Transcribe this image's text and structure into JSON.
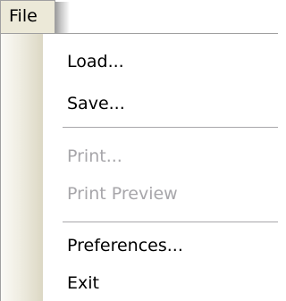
{
  "menubar": {
    "file_label": "File"
  },
  "menu": {
    "load_label": "Load...",
    "save_label": "Save...",
    "print_label": "Print...",
    "print_preview_label": "Print Preview",
    "preferences_label": "Preferences...",
    "exit_label": "Exit"
  },
  "state": {
    "print_enabled": false,
    "print_preview_enabled": false
  },
  "colors": {
    "menubar_background": "#ece9d8",
    "disabled_text": "#a7a6aa",
    "border": "#a0a0a0"
  }
}
